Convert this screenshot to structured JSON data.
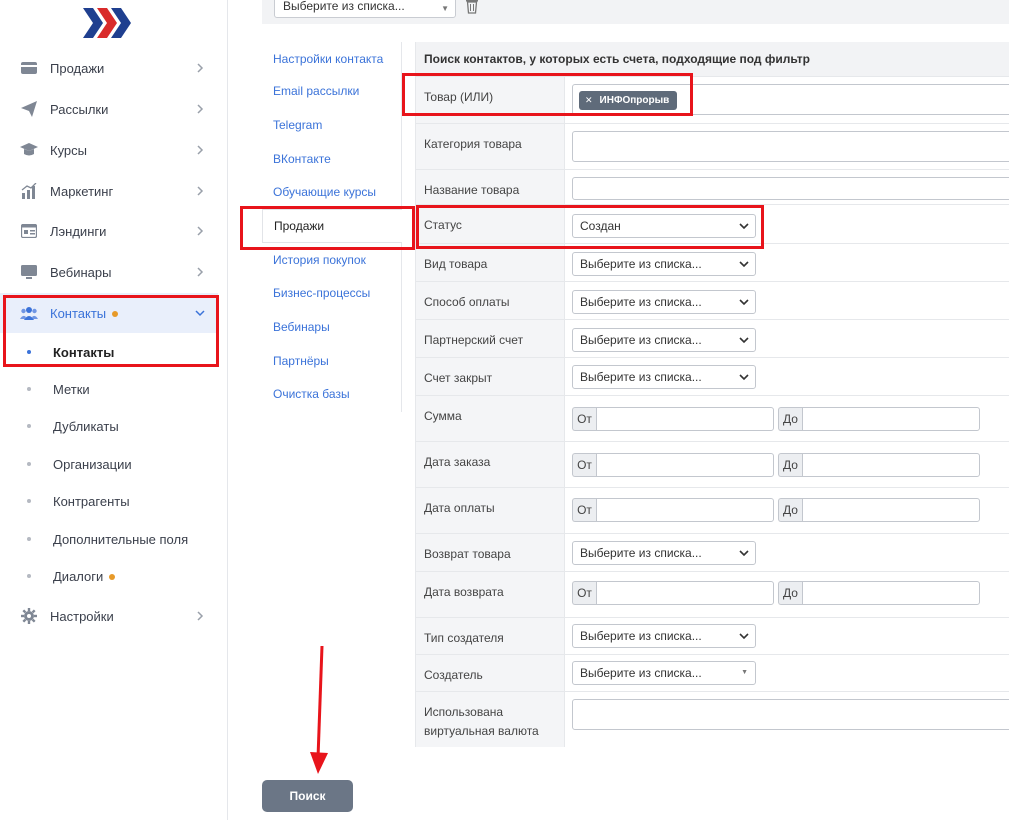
{
  "sidebar": {
    "items": [
      {
        "label": "Продажи"
      },
      {
        "label": "Рассылки"
      },
      {
        "label": "Курсы"
      },
      {
        "label": "Маркетинг"
      },
      {
        "label": "Лэндинги"
      },
      {
        "label": "Вебинары"
      },
      {
        "label": "Контакты"
      }
    ],
    "subitems": [
      {
        "label": "Контакты"
      },
      {
        "label": "Метки"
      },
      {
        "label": "Дубликаты"
      },
      {
        "label": "Организации"
      },
      {
        "label": "Контрагенты"
      },
      {
        "label": "Дополнительные поля"
      },
      {
        "label": "Диалоги"
      }
    ],
    "settings": {
      "label": "Настройки"
    },
    "accent_color": "#3b73d9",
    "badge_color": "#e79a29"
  },
  "topbar": {
    "select_value": "Выберите из списка..."
  },
  "subnav": {
    "items": [
      {
        "label": "Настройки контакта"
      },
      {
        "label": "Email рассылки"
      },
      {
        "label": "Telegram"
      },
      {
        "label": "ВКонтакте"
      },
      {
        "label": "Обучающие курсы"
      },
      {
        "label": "Продажи"
      },
      {
        "label": "История покупок"
      },
      {
        "label": "Бизнес-процессы"
      },
      {
        "label": "Вебинары"
      },
      {
        "label": "Партнёры"
      },
      {
        "label": "Очистка базы"
      }
    ],
    "active": "Продажи"
  },
  "filter": {
    "title": "Поиск контактов, у которых есть счета, подходящие под фильтр",
    "from_label": "От",
    "to_label": "До",
    "rows": [
      {
        "label": "Товар (ИЛИ)",
        "tag": "ИНФОпрорыв"
      },
      {
        "label": "Категория товара"
      },
      {
        "label": "Название товара",
        "value": ""
      },
      {
        "label": "Статус",
        "value": "Создан"
      },
      {
        "label": "Вид товара",
        "value": "Выберите из списка..."
      },
      {
        "label": "Способ оплаты",
        "value": "Выберите из списка..."
      },
      {
        "label": "Партнерский счет",
        "value": "Выберите из списка..."
      },
      {
        "label": "Счет закрыт",
        "value": "Выберите из списка..."
      },
      {
        "label": "Сумма"
      },
      {
        "label": "Дата заказа"
      },
      {
        "label": "Дата оплаты"
      },
      {
        "label": "Возврат товара",
        "value": "Выберите из списка..."
      },
      {
        "label": "Дата возврата"
      },
      {
        "label": "Тип создателя",
        "value": "Выберите из списка..."
      },
      {
        "label": "Создатель",
        "value": "Выберите из списка..."
      },
      {
        "label": "Использована виртуальная валюта"
      }
    ]
  },
  "search_button": {
    "label": "Поиск",
    "color": "#6b7686"
  },
  "annotation_color": "#e8141b"
}
